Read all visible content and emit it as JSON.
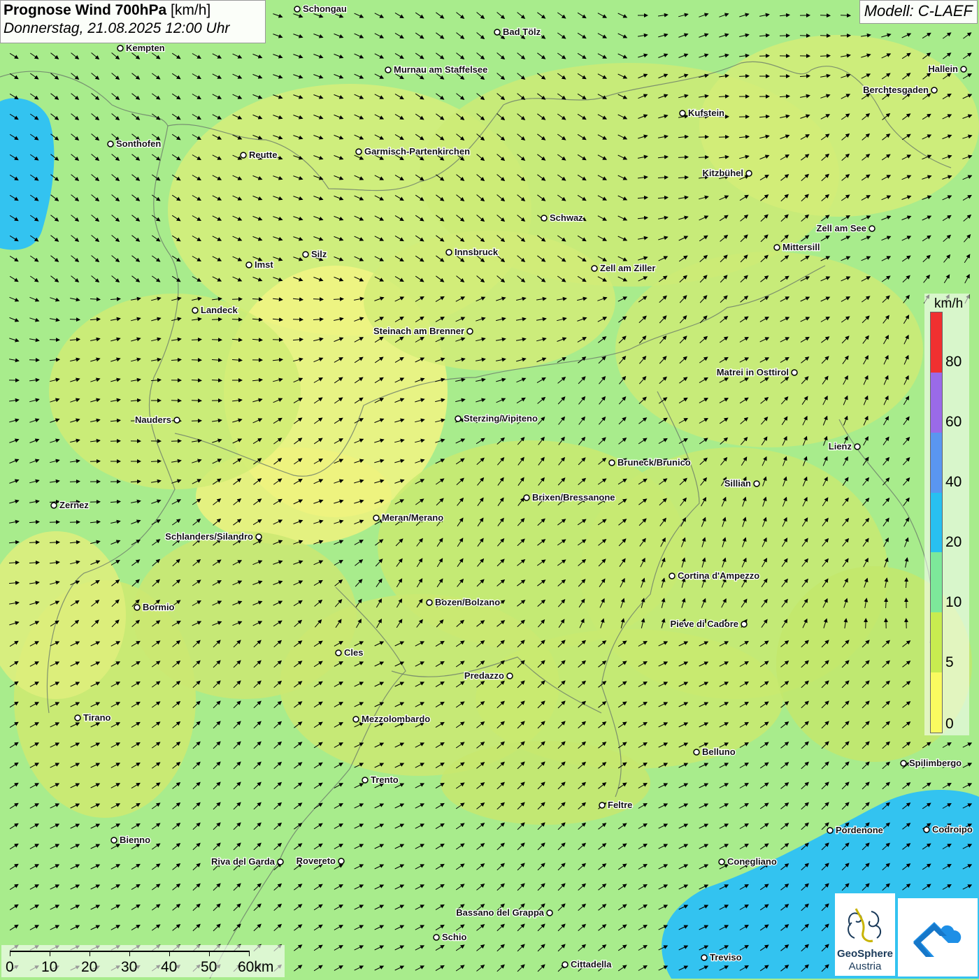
{
  "header": {
    "title_bold": "Prognose Wind 700hPa",
    "title_unit": "[km/h]",
    "datetime": "Donnerstag, 21.08.2025 12:00 Uhr"
  },
  "model_label": "Modell: C-LAEF",
  "legend": {
    "unit": "km/h",
    "labels": [
      "80",
      "60",
      "40",
      "20",
      "10",
      "5",
      "0"
    ],
    "colors": [
      "#f03030",
      "#9a6ae8",
      "#5a96f0",
      "#28c0f0",
      "#7de89a",
      "#c8ec50",
      "#fafa60"
    ]
  },
  "scalebar": {
    "labels": [
      "0",
      "10",
      "20",
      "30",
      "40",
      "50",
      "60km"
    ]
  },
  "cities": [
    {
      "name": "Schongau"
    },
    {
      "name": "Bad Tölz"
    },
    {
      "name": "Kempten"
    },
    {
      "name": "Murnau am Staffelsee"
    },
    {
      "name": "Hallein"
    },
    {
      "name": "Berchtesgaden"
    },
    {
      "name": "Kufstein"
    },
    {
      "name": "Sonthofen"
    },
    {
      "name": "Reutte"
    },
    {
      "name": "Garmisch-Partenkirchen"
    },
    {
      "name": "Kitzbühel"
    },
    {
      "name": "Schwaz"
    },
    {
      "name": "Zell am See"
    },
    {
      "name": "Mittersill"
    },
    {
      "name": "Imst"
    },
    {
      "name": "Silz"
    },
    {
      "name": "Innsbruck"
    },
    {
      "name": "Zell am Ziller"
    },
    {
      "name": "Landeck"
    },
    {
      "name": "Steinach am Brenner"
    },
    {
      "name": "Matrei in Osttirol"
    },
    {
      "name": "Nauders"
    },
    {
      "name": "Sterzing/Vipiteno"
    },
    {
      "name": "Lienz"
    },
    {
      "name": "Bruneck/Brunico"
    },
    {
      "name": "Sillian"
    },
    {
      "name": "Zernez"
    },
    {
      "name": "Brixen/Bressanone"
    },
    {
      "name": "Meran/Merano"
    },
    {
      "name": "Schlanders/Silandro"
    },
    {
      "name": "Cortina d'Ampezzo"
    },
    {
      "name": "Bozen/Bolzano"
    },
    {
      "name": "Bormio"
    },
    {
      "name": "Pieve di Cadore"
    },
    {
      "name": "Cles"
    },
    {
      "name": "Predazzo"
    },
    {
      "name": "Tirano"
    },
    {
      "name": "Mezzolombardo"
    },
    {
      "name": "Belluno"
    },
    {
      "name": "Spilimbergo"
    },
    {
      "name": "Trento"
    },
    {
      "name": "Feltre"
    },
    {
      "name": "Pordenone"
    },
    {
      "name": "Codroipo"
    },
    {
      "name": "Bienno"
    },
    {
      "name": "Riva del Garda"
    },
    {
      "name": "Rovereto"
    },
    {
      "name": "Conegliano"
    },
    {
      "name": "Bassano del Grappa"
    },
    {
      "name": "Schio"
    },
    {
      "name": "Treviso"
    },
    {
      "name": "Cittadella"
    }
  ],
  "logo": {
    "name_line1": "GeoSphere",
    "name_line2": "Austria"
  }
}
